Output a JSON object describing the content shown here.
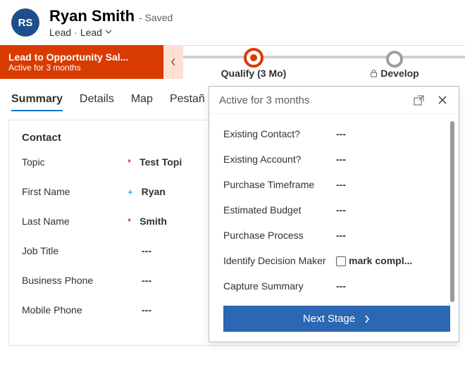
{
  "header": {
    "initials": "RS",
    "name": "Ryan Smith",
    "saved_suffix": "- Saved",
    "entity_primary": "Lead",
    "entity_secondary": "Lead"
  },
  "process": {
    "banner_title": "Lead to Opportunity Sal...",
    "banner_sub": "Active for 3 months",
    "stages": [
      {
        "label": "Qualify",
        "duration": "(3 Mo)",
        "active": true,
        "locked": false
      },
      {
        "label": "Develop",
        "duration": "",
        "active": false,
        "locked": true
      }
    ]
  },
  "tabs": [
    "Summary",
    "Details",
    "Map",
    "Pestañ"
  ],
  "contact": {
    "section_title": "Contact",
    "fields": [
      {
        "label": "Topic",
        "mark": "req",
        "value": "Test Topi"
      },
      {
        "label": "First Name",
        "mark": "rec",
        "value": "Ryan"
      },
      {
        "label": "Last Name",
        "mark": "req",
        "value": "Smith"
      },
      {
        "label": "Job Title",
        "mark": "",
        "value": "---"
      },
      {
        "label": "Business Phone",
        "mark": "",
        "value": "---"
      },
      {
        "label": "Mobile Phone",
        "mark": "",
        "value": "---"
      }
    ]
  },
  "flyout": {
    "title": "Active for 3 months",
    "rows": [
      {
        "label": "Existing Contact?",
        "value": "---",
        "type": "text"
      },
      {
        "label": "Existing Account?",
        "value": "---",
        "type": "text"
      },
      {
        "label": "Purchase Timeframe",
        "value": "---",
        "type": "text"
      },
      {
        "label": "Estimated Budget",
        "value": "---",
        "type": "text"
      },
      {
        "label": "Purchase Process",
        "value": "---",
        "type": "text"
      },
      {
        "label": "Identify Decision Maker",
        "value": "mark compl...",
        "type": "check"
      },
      {
        "label": "Capture Summary",
        "value": "---",
        "type": "text"
      }
    ],
    "next_label": "Next Stage"
  }
}
